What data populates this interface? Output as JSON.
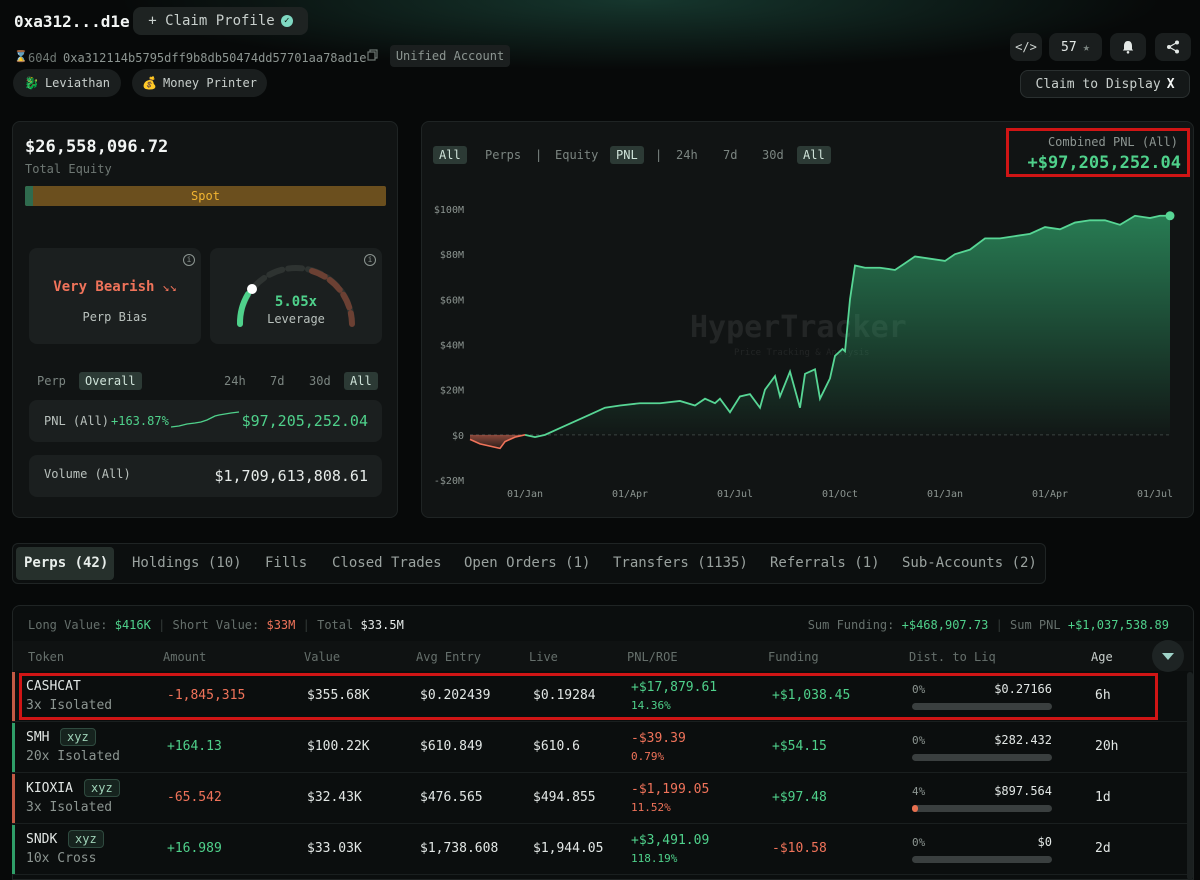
{
  "header": {
    "address_short": "0xa312...d1e",
    "claim_profile": "+ Claim Profile",
    "age": "604d",
    "address_full": "0xa312114b5795dff9b8db50474dd57701aa78ad1e",
    "account_type": "Unified Account",
    "badges": [
      {
        "icon": "whale-icon",
        "label": "Leviathan"
      },
      {
        "icon": "money-bag-icon",
        "label": "Money Printer"
      }
    ],
    "followers": "57",
    "claim_display": "Claim to Display"
  },
  "summary": {
    "total_equity": "$26,558,096.72",
    "total_equity_label": "Total Equity",
    "spot_label": "Spot",
    "bias_value": "Very Bearish",
    "bias_label": "Perp Bias",
    "leverage_value": "5.05x",
    "leverage_label": "Leverage",
    "filter_left": [
      "Perp",
      "Overall"
    ],
    "filter_right": [
      "24h",
      "7d",
      "30d",
      "All"
    ],
    "pnl_label": "PNL (All)",
    "pnl_pct": "+163.87%",
    "pnl_value": "$97,205,252.04",
    "volume_label": "Volume (All)",
    "volume_value": "$1,709,613,808.61"
  },
  "chart_controls": {
    "group1": [
      "All",
      "Perps"
    ],
    "separator": "|",
    "group2": [
      "Equity",
      "PNL"
    ],
    "group3": [
      "24h",
      "7d",
      "30d",
      "All"
    ],
    "combined_label": "Combined PNL (All)",
    "combined_value": "+$97,205,252.04",
    "watermark": "HyperTracker",
    "watermark_sub": "Price Tracking & Analysis"
  },
  "chart_data": {
    "type": "area",
    "xlabel": "",
    "ylabel": "",
    "y_ticks": [
      "$100M",
      "$80M",
      "$60M",
      "$40M",
      "$20M",
      "$0",
      "-$20M"
    ],
    "ylim": [
      -20,
      100
    ],
    "x_ticks": [
      "01/Jan",
      "01/Apr",
      "01/Jul",
      "01/Oct",
      "01/Jan",
      "01/Apr",
      "01/Jul"
    ],
    "x_tick_positions": [
      0.11,
      0.32,
      0.53,
      0.74,
      0.95,
      1.16,
      1.37
    ],
    "x_range": [
      0,
      1.4
    ],
    "series": [
      {
        "values_x": [
          0,
          0.02,
          0.04,
          0.06,
          0.07,
          0.09,
          0.11,
          0.13,
          0.15,
          0.18,
          0.21,
          0.24,
          0.27,
          0.3,
          0.34,
          0.38,
          0.42,
          0.45,
          0.47,
          0.49,
          0.5,
          0.52,
          0.54,
          0.56,
          0.58,
          0.59,
          0.61,
          0.62,
          0.64,
          0.66,
          0.67,
          0.69,
          0.7,
          0.72,
          0.73,
          0.745,
          0.75,
          0.76,
          0.77,
          0.79,
          0.82,
          0.85,
          0.87,
          0.89,
          0.92,
          0.95,
          0.97,
          1.0,
          1.03,
          1.06,
          1.09,
          1.12,
          1.15,
          1.18,
          1.21,
          1.24,
          1.27,
          1.3,
          1.33,
          1.36,
          1.38,
          1.4
        ],
        "values_y": [
          -2,
          -4,
          -5,
          -6,
          -3,
          -1,
          0,
          -1,
          0,
          3,
          6,
          9,
          12,
          13,
          14,
          14,
          15,
          13,
          16,
          14,
          16,
          10,
          17,
          18,
          12,
          20,
          26,
          17,
          28,
          12,
          27,
          29,
          16,
          25,
          35,
          38,
          37,
          60,
          75,
          74,
          74,
          73,
          76,
          79,
          78,
          77,
          80,
          82,
          87,
          87,
          88,
          89,
          92,
          91,
          94,
          95,
          95,
          93,
          97,
          96,
          97,
          97
        ]
      }
    ],
    "grid": false
  },
  "tabs": [
    "Perps (42)",
    "Holdings (10)",
    "Fills",
    "Closed Trades",
    "Open Orders (1)",
    "Transfers (1135)",
    "Referrals (1)",
    "Sub-Accounts (2)"
  ],
  "stats": {
    "long_label": "Long Value:",
    "long_value": "$416K",
    "short_label": "Short Value:",
    "short_value": "$33M",
    "total_label": "Total",
    "total_value": "$33.5M",
    "funding_label": "Sum Funding:",
    "funding_value": "+$468,907.73",
    "sumpnl_label": "Sum PNL",
    "sumpnl_value": "+$1,037,538.89"
  },
  "table": {
    "headers": [
      "Token",
      "Amount",
      "Value",
      "Avg Entry",
      "Live",
      "PNL/ROE",
      "Funding",
      "Dist. to Liq",
      "Age"
    ],
    "rows": [
      {
        "token": "CASHCAT",
        "tag": "",
        "mode": "3x Isolated",
        "amount": "-1,845,315",
        "value": "$355.68K",
        "entry": "$0.202439",
        "live": "$0.19284",
        "pnl": "+$17,879.61",
        "roe": "14.36%",
        "funding": "+$1,038.45",
        "liq_pct": "0%",
        "liq_price": "$0.27166",
        "liq_fill": 0.0,
        "age": "6h",
        "side": "short"
      },
      {
        "token": "SMH",
        "tag": "xyz",
        "mode": "20x Isolated",
        "amount": "+164.13",
        "value": "$100.22K",
        "entry": "$610.849",
        "live": "$610.6",
        "pnl": "-$39.39",
        "roe": "0.79%",
        "funding": "+$54.15",
        "liq_pct": "0%",
        "liq_price": "$282.432",
        "liq_fill": 0.0,
        "age": "20h",
        "side": "long"
      },
      {
        "token": "KIOXIA",
        "tag": "xyz",
        "mode": "3x Isolated",
        "amount": "-65.542",
        "value": "$32.43K",
        "entry": "$476.565",
        "live": "$494.855",
        "pnl": "-$1,199.05",
        "roe": "11.52%",
        "funding": "+$97.48",
        "liq_pct": "4%",
        "liq_price": "$897.564",
        "liq_fill": 0.04,
        "age": "1d",
        "side": "short"
      },
      {
        "token": "SNDK",
        "tag": "xyz",
        "mode": "10x Cross",
        "amount": "+16.989",
        "value": "$33.03K",
        "entry": "$1,738.608",
        "live": "$1,944.05",
        "pnl": "+$3,491.09",
        "roe": "118.19%",
        "funding": "-$10.58",
        "liq_pct": "0%",
        "liq_price": "$0",
        "liq_fill": 0.0,
        "age": "2d",
        "side": "long"
      }
    ]
  },
  "colors": {
    "accent": "#4fd18b",
    "negative": "#f0735a",
    "highlight_box": "#d01515"
  }
}
